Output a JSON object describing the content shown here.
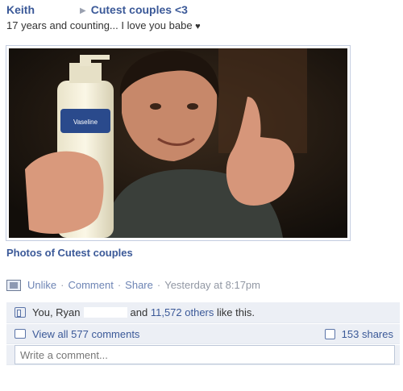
{
  "post": {
    "author": "Keith",
    "group": "Cutest couples <3",
    "status": "17 years and counting... I love you babe",
    "heart": "♥",
    "album_link": "Photos of Cutest couples"
  },
  "actions": {
    "unlike": "Unlike",
    "comment": "Comment",
    "share": "Share",
    "sep": "·",
    "time": "Yesterday at 8:17pm"
  },
  "likes": {
    "prefix": "You, Ryan",
    "and": "and",
    "others": "11,572 others",
    "suffix": "like this."
  },
  "comments": {
    "view_all": "View all 577 comments",
    "shares": "153 shares",
    "placeholder": "Write a comment..."
  },
  "photo": {
    "bottle_label": "Vaseline"
  }
}
